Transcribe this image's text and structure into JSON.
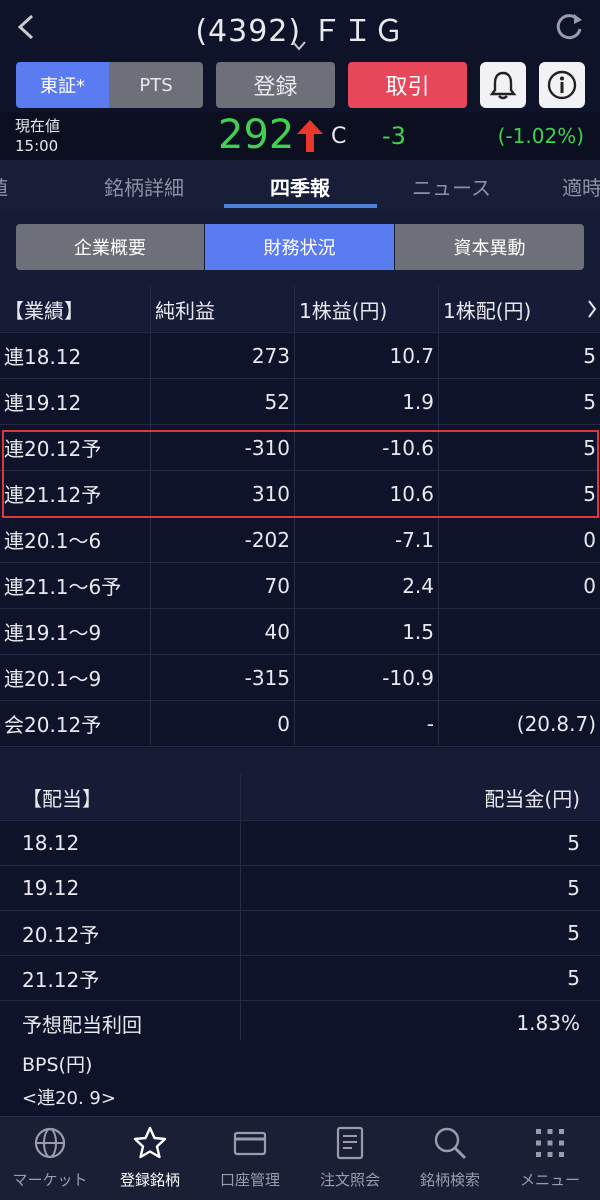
{
  "header": {
    "title": "(4392) ＦＩＧ"
  },
  "toolbar": {
    "market_tse": "東証*",
    "market_pts": "PTS",
    "register": "登録",
    "trade": "取引"
  },
  "price": {
    "label_line1": "現在値",
    "label_line2": "15:00",
    "value": "292",
    "mark": "C",
    "change": "-3",
    "change_pct": "(-1.02%)"
  },
  "tabs": [
    "値",
    "銘柄詳細",
    "四季報",
    "ニュース",
    "適時"
  ],
  "subtabs": [
    "企業概要",
    "財務状況",
    "資本異動"
  ],
  "results": {
    "headers": [
      "【業績】",
      "純利益",
      "1株益(円)",
      "1株配(円)"
    ],
    "rows": [
      [
        "連18.12",
        "273",
        "10.7",
        "5"
      ],
      [
        "連19.12",
        "52",
        "1.9",
        "5"
      ],
      [
        "連20.12予",
        "-310",
        "-10.6",
        "5"
      ],
      [
        "連21.12予",
        "310",
        "10.6",
        "5"
      ],
      [
        "連20.1～6",
        "-202",
        "-7.1",
        "0"
      ],
      [
        "連21.1～6予",
        "70",
        "2.4",
        "0"
      ],
      [
        "連19.1～9",
        "40",
        "1.5",
        ""
      ],
      [
        "連20.1～9",
        "-315",
        "-10.9",
        ""
      ],
      [
        "会20.12予",
        "0",
        "-",
        "(20.8.7)"
      ]
    ]
  },
  "dividend": {
    "headers": [
      "【配当】",
      "配当金(円)"
    ],
    "rows": [
      [
        "18.12",
        "5"
      ],
      [
        "19.12",
        "5"
      ],
      [
        "20.12予",
        "5"
      ],
      [
        "21.12予",
        "5"
      ],
      [
        "予想配当利回",
        "1.83%"
      ]
    ]
  },
  "bps": {
    "label": "BPS(円)",
    "sub": "<連20. 9>"
  },
  "bottom_nav": [
    "マーケット",
    "登録銘柄",
    "口座管理",
    "注文照会",
    "銘柄検索",
    "メニュー"
  ],
  "colors": {
    "accent_blue": "#5b7cf0",
    "trade_red": "#e8475a",
    "price_green": "#3fd14f",
    "up_arrow_red": "#e8372b",
    "highlight_border": "#d93b3b"
  }
}
